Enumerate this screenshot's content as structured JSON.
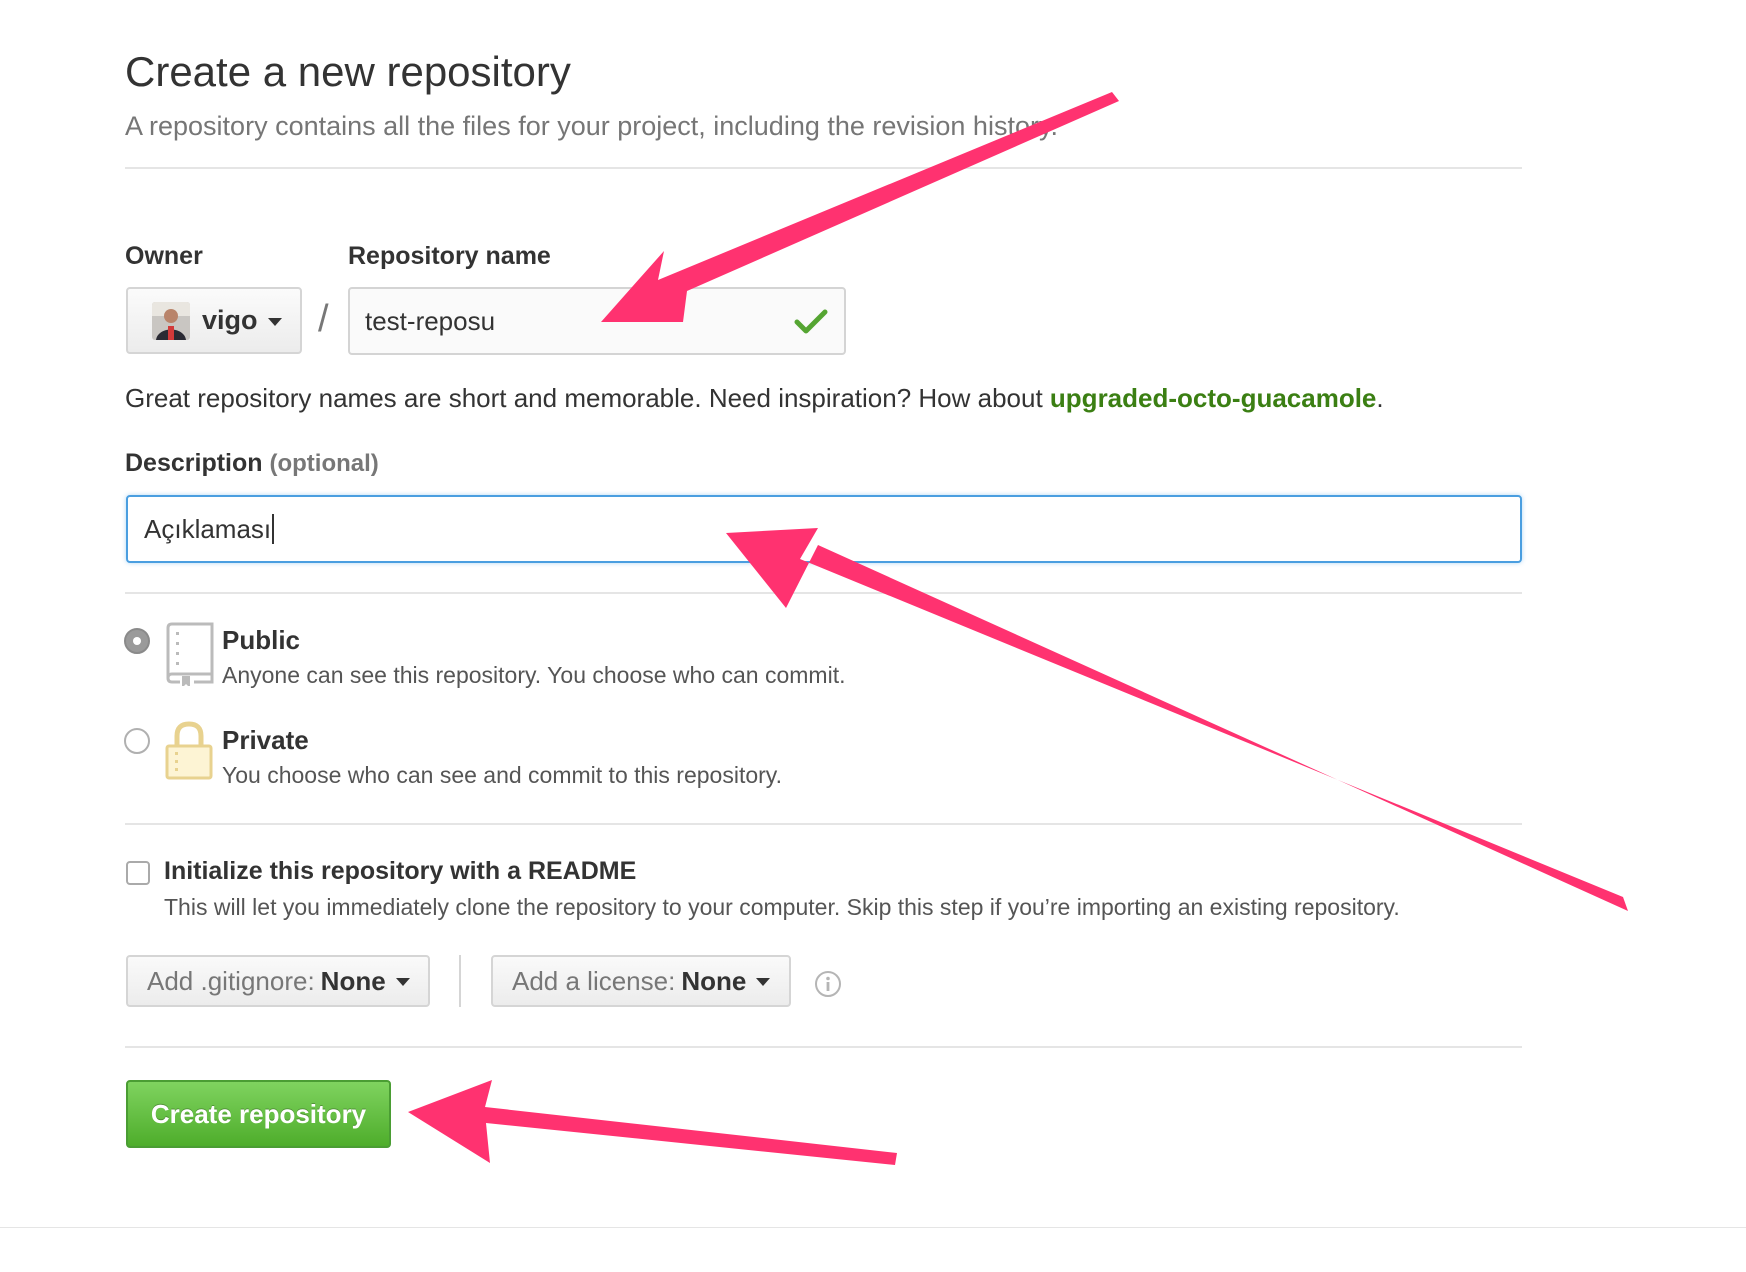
{
  "page": {
    "title": "Create a new repository",
    "subtitle": "A repository contains all the files for your project, including the revision history."
  },
  "owner": {
    "label": "Owner",
    "name": "vigo"
  },
  "repo_name": {
    "label": "Repository name",
    "separator": "/",
    "value": "test-reposu",
    "status_icon": "check-icon"
  },
  "hint": {
    "text": "Great repository names are short and memorable. Need inspiration? How about ",
    "suggestion": "upgraded-octo-guacamole",
    "end": "."
  },
  "description": {
    "label": "Description",
    "optional": "(optional)",
    "value": "Açıklaması"
  },
  "visibility": {
    "public": {
      "title": "Public",
      "desc": "Anyone can see this repository. You choose who can commit.",
      "selected": true,
      "icon": "repo-book-icon"
    },
    "private": {
      "title": "Private",
      "desc": "You choose who can see and commit to this repository.",
      "selected": false,
      "icon": "lock-icon"
    }
  },
  "readme": {
    "title": "Initialize this repository with a README",
    "desc": "This will let you immediately clone the repository to your computer. Skip this step if you’re importing an existing repository.",
    "checked": false
  },
  "gitignore": {
    "prefix": "Add .gitignore:",
    "value": "None"
  },
  "license": {
    "prefix": "Add a license:",
    "value": "None"
  },
  "create_button": {
    "label": "Create repository"
  },
  "colors": {
    "annotation_arrow": "#ff3270",
    "create_button": "#5cb933",
    "suggestion_link": "#3b7f13",
    "focus_border": "#4a9ee0"
  }
}
